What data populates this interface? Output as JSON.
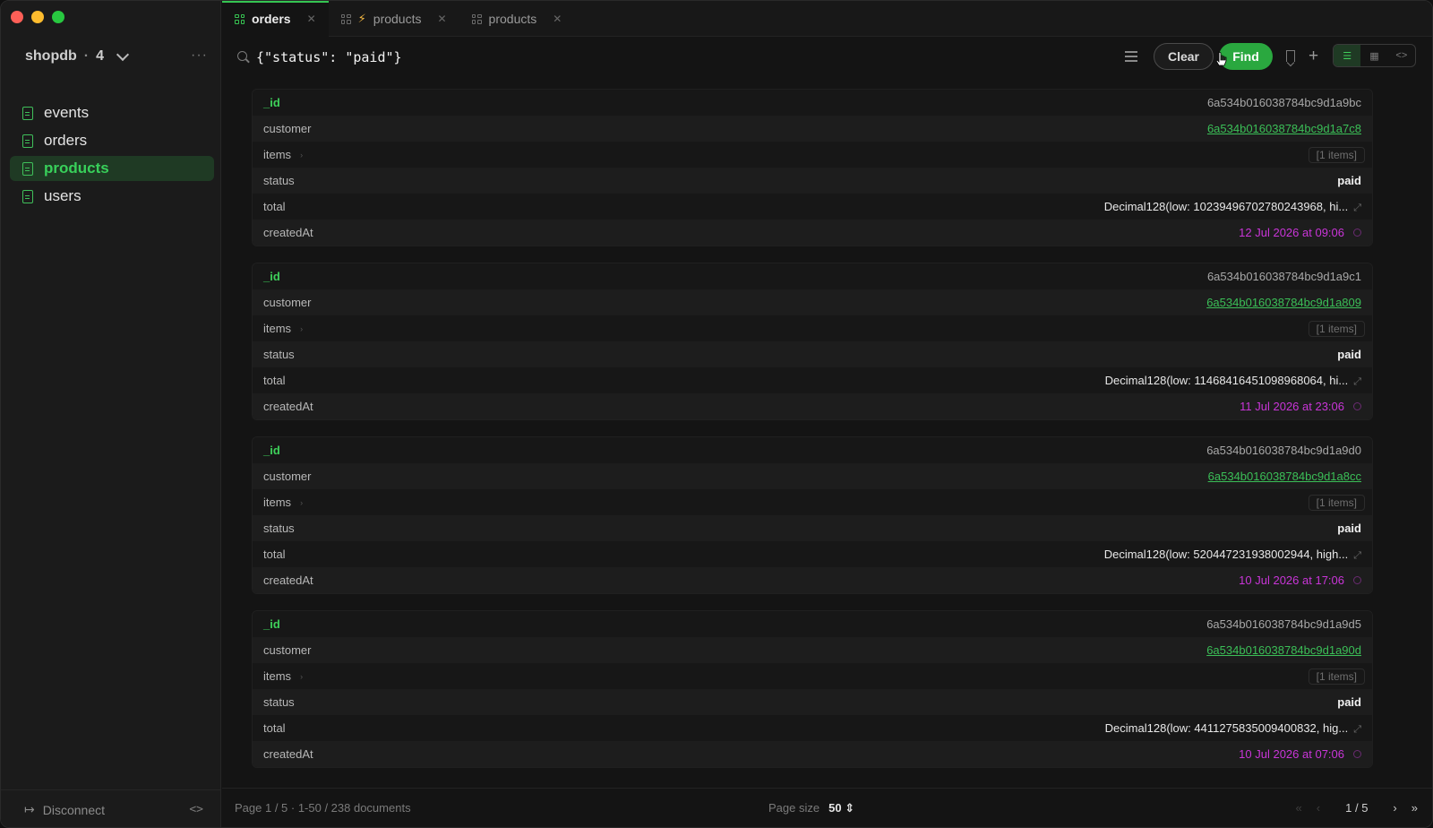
{
  "sidebar": {
    "db_name": "shopdb",
    "db_count": "4",
    "collections": [
      {
        "label": "events",
        "active": false
      },
      {
        "label": "orders",
        "active": false
      },
      {
        "label": "products",
        "active": true
      },
      {
        "label": "users",
        "active": false
      }
    ],
    "disconnect_label": "Disconnect"
  },
  "tabs": [
    {
      "label": "orders",
      "active": true,
      "icon": "grid-icon"
    },
    {
      "label": "products",
      "active": false,
      "icon": "bolt-icon"
    },
    {
      "label": "products",
      "active": false,
      "icon": "grid-icon"
    }
  ],
  "query": {
    "value": "{\"status\": \"paid\"}",
    "clear_label": "Clear",
    "find_label": "Find"
  },
  "documents": [
    {
      "id": "6a534b016038784bc9d1a9bc",
      "customer": "6a534b016038784bc9d1a7c8",
      "items": "[1 items]",
      "status": "paid",
      "total": "Decimal128(low: 10239496702780243968, hi...",
      "createdAt": "12 Jul 2026 at 09:06"
    },
    {
      "id": "6a534b016038784bc9d1a9c1",
      "customer": "6a534b016038784bc9d1a809",
      "items": "[1 items]",
      "status": "paid",
      "total": "Decimal128(low: 11468416451098968064, hi...",
      "createdAt": "11 Jul 2026 at 23:06"
    },
    {
      "id": "6a534b016038784bc9d1a9d0",
      "customer": "6a534b016038784bc9d1a8cc",
      "items": "[1 items]",
      "status": "paid",
      "total": "Decimal128(low: 520447231938002944, high...",
      "createdAt": "10 Jul 2026 at 17:06"
    },
    {
      "id": "6a534b016038784bc9d1a9d5",
      "customer": "6a534b016038784bc9d1a90d",
      "items": "[1 items]",
      "status": "paid",
      "total": "Decimal128(low: 4411275835009400832, hig...",
      "createdAt": "10 Jul 2026 at 07:06"
    }
  ],
  "field_labels": {
    "id": "_id",
    "customer": "customer",
    "items": "items",
    "status": "status",
    "total": "total",
    "createdAt": "createdAt"
  },
  "footer": {
    "page_info": "Page 1 / 5  ·  1-50 / 238 documents",
    "page_size_label": "Page size",
    "page_size_value": "50",
    "pager": "1 / 5"
  },
  "colors": {
    "accent": "#2aa83f",
    "date": "#c935d8",
    "link": "#3bbf57"
  }
}
